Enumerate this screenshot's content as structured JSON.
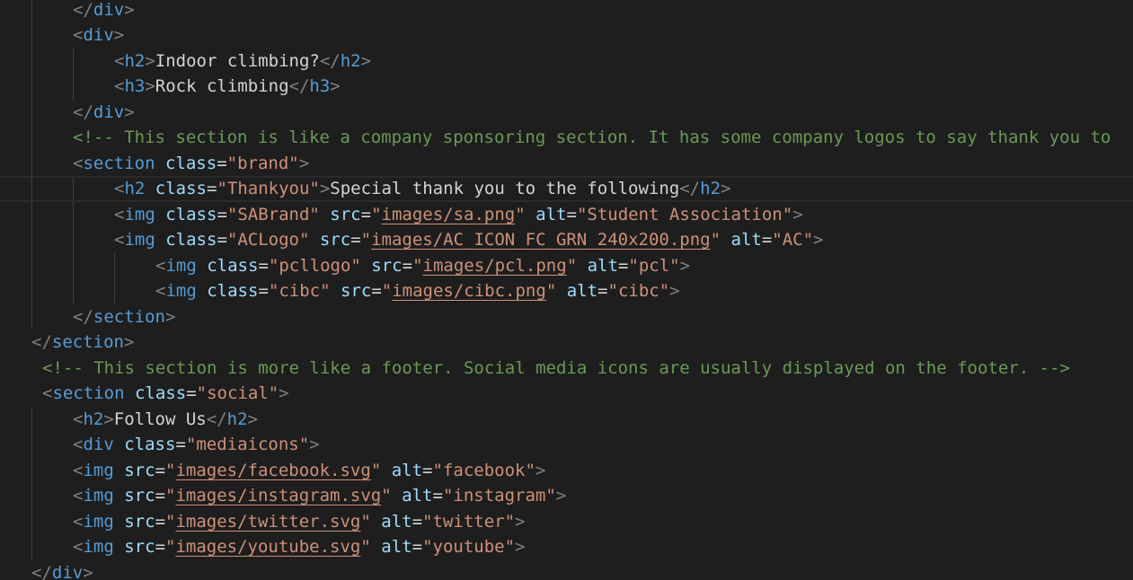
{
  "editor": {
    "language": "html",
    "colors": {
      "background": "#1e1e1e",
      "tag": "#569cd6",
      "punctuation": "#808080",
      "attribute": "#9cdcfe",
      "string": "#ce9178",
      "comment": "#6a9955",
      "text": "#d4d4d4"
    },
    "lines": [
      [
        {
          "k": "p",
          "v": "</"
        },
        {
          "k": "t",
          "v": "div"
        },
        {
          "k": "p",
          "v": ">"
        }
      ],
      [
        {
          "k": "p",
          "v": "<"
        },
        {
          "k": "t",
          "v": "div"
        },
        {
          "k": "p",
          "v": ">"
        }
      ],
      [
        {
          "k": "p",
          "v": "<"
        },
        {
          "k": "t",
          "v": "h2"
        },
        {
          "k": "p",
          "v": ">"
        },
        {
          "k": "x",
          "v": "Indoor climbing?"
        },
        {
          "k": "p",
          "v": "</"
        },
        {
          "k": "t",
          "v": "h2"
        },
        {
          "k": "p",
          "v": ">"
        }
      ],
      [
        {
          "k": "p",
          "v": "<"
        },
        {
          "k": "t",
          "v": "h3"
        },
        {
          "k": "p",
          "v": ">"
        },
        {
          "k": "x",
          "v": "Rock climbing"
        },
        {
          "k": "p",
          "v": "</"
        },
        {
          "k": "t",
          "v": "h3"
        },
        {
          "k": "p",
          "v": ">"
        }
      ],
      [
        {
          "k": "p",
          "v": "</"
        },
        {
          "k": "t",
          "v": "div"
        },
        {
          "k": "p",
          "v": ">"
        }
      ],
      [
        {
          "k": "c",
          "v": "<!-- This section is like a company sponsoring section. It has some company logos to say thank you to"
        }
      ],
      [
        {
          "k": "p",
          "v": "<"
        },
        {
          "k": "t",
          "v": "section"
        },
        {
          "k": "x",
          "v": " "
        },
        {
          "k": "a",
          "v": "class"
        },
        {
          "k": "x",
          "v": "="
        },
        {
          "k": "s",
          "v": "\"brand\""
        },
        {
          "k": "p",
          "v": ">"
        }
      ],
      [
        {
          "k": "p",
          "v": "<"
        },
        {
          "k": "t",
          "v": "h2"
        },
        {
          "k": "x",
          "v": " "
        },
        {
          "k": "a",
          "v": "class"
        },
        {
          "k": "x",
          "v": "="
        },
        {
          "k": "s",
          "v": "\"Thankyou\""
        },
        {
          "k": "p",
          "v": ">"
        },
        {
          "k": "x",
          "v": "Special thank you to the following"
        },
        {
          "k": "p",
          "v": "</"
        },
        {
          "k": "t",
          "v": "h2"
        },
        {
          "k": "p",
          "v": ">"
        }
      ],
      [
        {
          "k": "p",
          "v": "<"
        },
        {
          "k": "t",
          "v": "img"
        },
        {
          "k": "x",
          "v": " "
        },
        {
          "k": "a",
          "v": "class"
        },
        {
          "k": "x",
          "v": "="
        },
        {
          "k": "s",
          "v": "\"SABrand\""
        },
        {
          "k": "x",
          "v": " "
        },
        {
          "k": "a",
          "v": "src"
        },
        {
          "k": "x",
          "v": "="
        },
        {
          "k": "s",
          "v": "\""
        },
        {
          "k": "su",
          "v": "images/sa.png"
        },
        {
          "k": "s",
          "v": "\""
        },
        {
          "k": "x",
          "v": " "
        },
        {
          "k": "a",
          "v": "alt"
        },
        {
          "k": "x",
          "v": "="
        },
        {
          "k": "s",
          "v": "\"Student Association\""
        },
        {
          "k": "p",
          "v": ">"
        }
      ],
      [
        {
          "k": "p",
          "v": "<"
        },
        {
          "k": "t",
          "v": "img"
        },
        {
          "k": "x",
          "v": " "
        },
        {
          "k": "a",
          "v": "class"
        },
        {
          "k": "x",
          "v": "="
        },
        {
          "k": "s",
          "v": "\"ACLogo\""
        },
        {
          "k": "x",
          "v": " "
        },
        {
          "k": "a",
          "v": "src"
        },
        {
          "k": "x",
          "v": "="
        },
        {
          "k": "s",
          "v": "\""
        },
        {
          "k": "su",
          "v": "images/AC_ICON_FC_GRN_240x200.png"
        },
        {
          "k": "s",
          "v": "\""
        },
        {
          "k": "x",
          "v": " "
        },
        {
          "k": "a",
          "v": "alt"
        },
        {
          "k": "x",
          "v": "="
        },
        {
          "k": "s",
          "v": "\"AC\""
        },
        {
          "k": "p",
          "v": ">"
        }
      ],
      [
        {
          "k": "p",
          "v": "<"
        },
        {
          "k": "t",
          "v": "img"
        },
        {
          "k": "x",
          "v": " "
        },
        {
          "k": "a",
          "v": "class"
        },
        {
          "k": "x",
          "v": "="
        },
        {
          "k": "s",
          "v": "\"pcllogo\""
        },
        {
          "k": "x",
          "v": " "
        },
        {
          "k": "a",
          "v": "src"
        },
        {
          "k": "x",
          "v": "="
        },
        {
          "k": "s",
          "v": "\""
        },
        {
          "k": "su",
          "v": "images/pcl.png"
        },
        {
          "k": "s",
          "v": "\""
        },
        {
          "k": "x",
          "v": " "
        },
        {
          "k": "a",
          "v": "alt"
        },
        {
          "k": "x",
          "v": "="
        },
        {
          "k": "s",
          "v": "\"pcl\""
        },
        {
          "k": "p",
          "v": ">"
        }
      ],
      [
        {
          "k": "p",
          "v": "<"
        },
        {
          "k": "t",
          "v": "img"
        },
        {
          "k": "x",
          "v": " "
        },
        {
          "k": "a",
          "v": "class"
        },
        {
          "k": "x",
          "v": "="
        },
        {
          "k": "s",
          "v": "\"cibc\""
        },
        {
          "k": "x",
          "v": " "
        },
        {
          "k": "a",
          "v": "src"
        },
        {
          "k": "x",
          "v": "="
        },
        {
          "k": "s",
          "v": "\""
        },
        {
          "k": "su",
          "v": "images/cibc.png"
        },
        {
          "k": "s",
          "v": "\""
        },
        {
          "k": "x",
          "v": " "
        },
        {
          "k": "a",
          "v": "alt"
        },
        {
          "k": "x",
          "v": "="
        },
        {
          "k": "s",
          "v": "\"cibc\""
        },
        {
          "k": "p",
          "v": ">"
        }
      ],
      [
        {
          "k": "p",
          "v": "</"
        },
        {
          "k": "t",
          "v": "section"
        },
        {
          "k": "p",
          "v": ">"
        }
      ],
      [
        {
          "k": "p",
          "v": "</"
        },
        {
          "k": "t",
          "v": "section"
        },
        {
          "k": "p",
          "v": ">"
        }
      ],
      [
        {
          "k": "c",
          "v": "<!-- This section is more like a footer. Social media icons are usually displayed on the footer. -->"
        }
      ],
      [
        {
          "k": "p",
          "v": "<"
        },
        {
          "k": "t",
          "v": "section"
        },
        {
          "k": "x",
          "v": " "
        },
        {
          "k": "a",
          "v": "class"
        },
        {
          "k": "x",
          "v": "="
        },
        {
          "k": "s",
          "v": "\"social\""
        },
        {
          "k": "p",
          "v": ">"
        }
      ],
      [
        {
          "k": "p",
          "v": "<"
        },
        {
          "k": "t",
          "v": "h2"
        },
        {
          "k": "p",
          "v": ">"
        },
        {
          "k": "x",
          "v": "Follow Us"
        },
        {
          "k": "p",
          "v": "</"
        },
        {
          "k": "t",
          "v": "h2"
        },
        {
          "k": "p",
          "v": ">"
        }
      ],
      [
        {
          "k": "p",
          "v": "<"
        },
        {
          "k": "t",
          "v": "div"
        },
        {
          "k": "x",
          "v": " "
        },
        {
          "k": "a",
          "v": "class"
        },
        {
          "k": "x",
          "v": "="
        },
        {
          "k": "s",
          "v": "\"mediaicons\""
        },
        {
          "k": "p",
          "v": ">"
        }
      ],
      [
        {
          "k": "p",
          "v": "<"
        },
        {
          "k": "t",
          "v": "img"
        },
        {
          "k": "x",
          "v": " "
        },
        {
          "k": "a",
          "v": "src"
        },
        {
          "k": "x",
          "v": "="
        },
        {
          "k": "s",
          "v": "\""
        },
        {
          "k": "su",
          "v": "images/facebook.svg"
        },
        {
          "k": "s",
          "v": "\""
        },
        {
          "k": "x",
          "v": " "
        },
        {
          "k": "a",
          "v": "alt"
        },
        {
          "k": "x",
          "v": "="
        },
        {
          "k": "s",
          "v": "\"facebook\""
        },
        {
          "k": "p",
          "v": ">"
        }
      ],
      [
        {
          "k": "p",
          "v": "<"
        },
        {
          "k": "t",
          "v": "img"
        },
        {
          "k": "x",
          "v": " "
        },
        {
          "k": "a",
          "v": "src"
        },
        {
          "k": "x",
          "v": "="
        },
        {
          "k": "s",
          "v": "\""
        },
        {
          "k": "su",
          "v": "images/instagram.svg"
        },
        {
          "k": "s",
          "v": "\""
        },
        {
          "k": "x",
          "v": " "
        },
        {
          "k": "a",
          "v": "alt"
        },
        {
          "k": "x",
          "v": "="
        },
        {
          "k": "s",
          "v": "\"instagram\""
        },
        {
          "k": "p",
          "v": ">"
        }
      ],
      [
        {
          "k": "p",
          "v": "<"
        },
        {
          "k": "t",
          "v": "img"
        },
        {
          "k": "x",
          "v": " "
        },
        {
          "k": "a",
          "v": "src"
        },
        {
          "k": "x",
          "v": "="
        },
        {
          "k": "s",
          "v": "\""
        },
        {
          "k": "su",
          "v": "images/twitter.svg"
        },
        {
          "k": "s",
          "v": "\""
        },
        {
          "k": "x",
          "v": " "
        },
        {
          "k": "a",
          "v": "alt"
        },
        {
          "k": "x",
          "v": "="
        },
        {
          "k": "s",
          "v": "\"twitter\""
        },
        {
          "k": "p",
          "v": ">"
        }
      ],
      [
        {
          "k": "p",
          "v": "<"
        },
        {
          "k": "t",
          "v": "img"
        },
        {
          "k": "x",
          "v": " "
        },
        {
          "k": "a",
          "v": "src"
        },
        {
          "k": "x",
          "v": "="
        },
        {
          "k": "s",
          "v": "\""
        },
        {
          "k": "su",
          "v": "images/youtube.svg"
        },
        {
          "k": "s",
          "v": "\""
        },
        {
          "k": "x",
          "v": " "
        },
        {
          "k": "a",
          "v": "alt"
        },
        {
          "k": "x",
          "v": "="
        },
        {
          "k": "s",
          "v": "\"youtube\""
        },
        {
          "k": "p",
          "v": ">"
        }
      ],
      [
        {
          "k": "p",
          "v": "</"
        },
        {
          "k": "t",
          "v": "div"
        },
        {
          "k": "p",
          "v": ">"
        }
      ]
    ]
  }
}
